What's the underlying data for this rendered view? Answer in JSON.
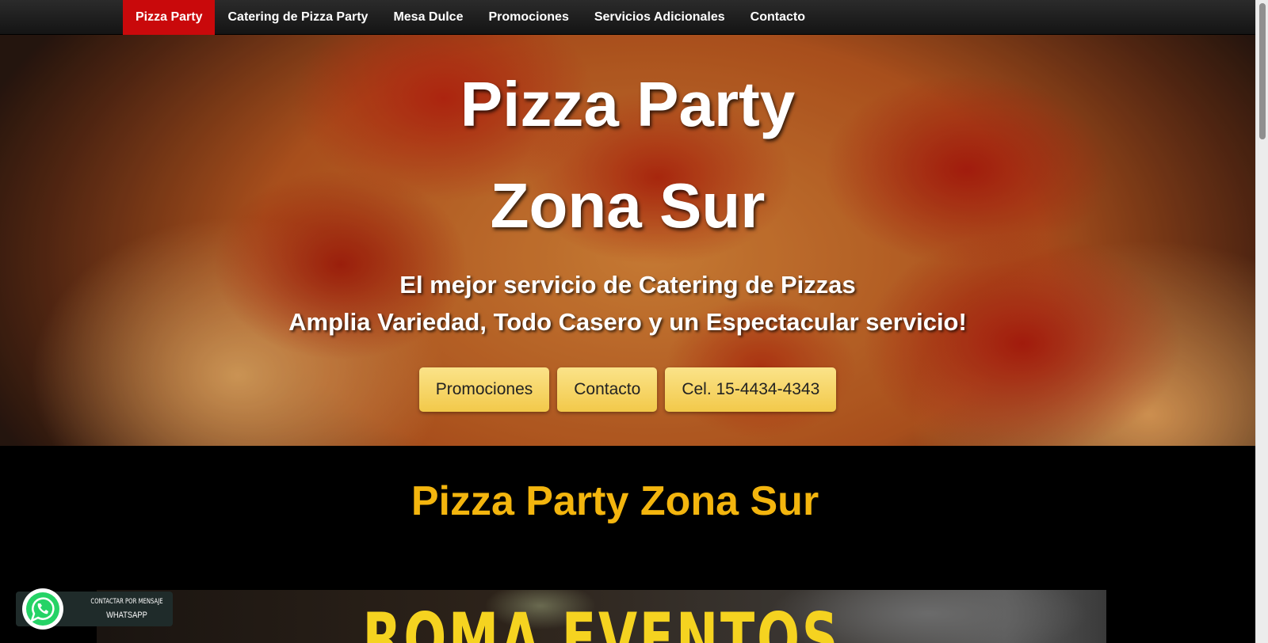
{
  "nav": {
    "items": [
      {
        "label": "Pizza Party",
        "active": true
      },
      {
        "label": "Catering de Pizza Party",
        "active": false
      },
      {
        "label": "Mesa Dulce",
        "active": false
      },
      {
        "label": "Promociones",
        "active": false
      },
      {
        "label": "Servicios Adicionales",
        "active": false
      },
      {
        "label": "Contacto",
        "active": false
      }
    ],
    "active_color": "#c9090b"
  },
  "hero": {
    "title_line1": "Pizza Party",
    "title_line2": "Zona Sur",
    "subtitle_line1": "El mejor servicio de Catering de Pizzas",
    "subtitle_line2": "Amplia Variedad, Todo Casero y un Espectacular servicio!",
    "buttons": [
      "Promociones",
      "Contacto",
      "Cel. 15-4434-4343"
    ],
    "button_color": "#f2c94a"
  },
  "section": {
    "title": "Pizza Party Zona Sur",
    "title_color": "#f3b50e"
  },
  "banner": {
    "text": "ROMA EVENTOS",
    "text_color": "#f5d320"
  },
  "whatsapp": {
    "line1": "CONTACTAR POR MENSAJE",
    "line2": "WHATSAPP",
    "icon": "whatsapp-icon",
    "color": "#25d366"
  }
}
